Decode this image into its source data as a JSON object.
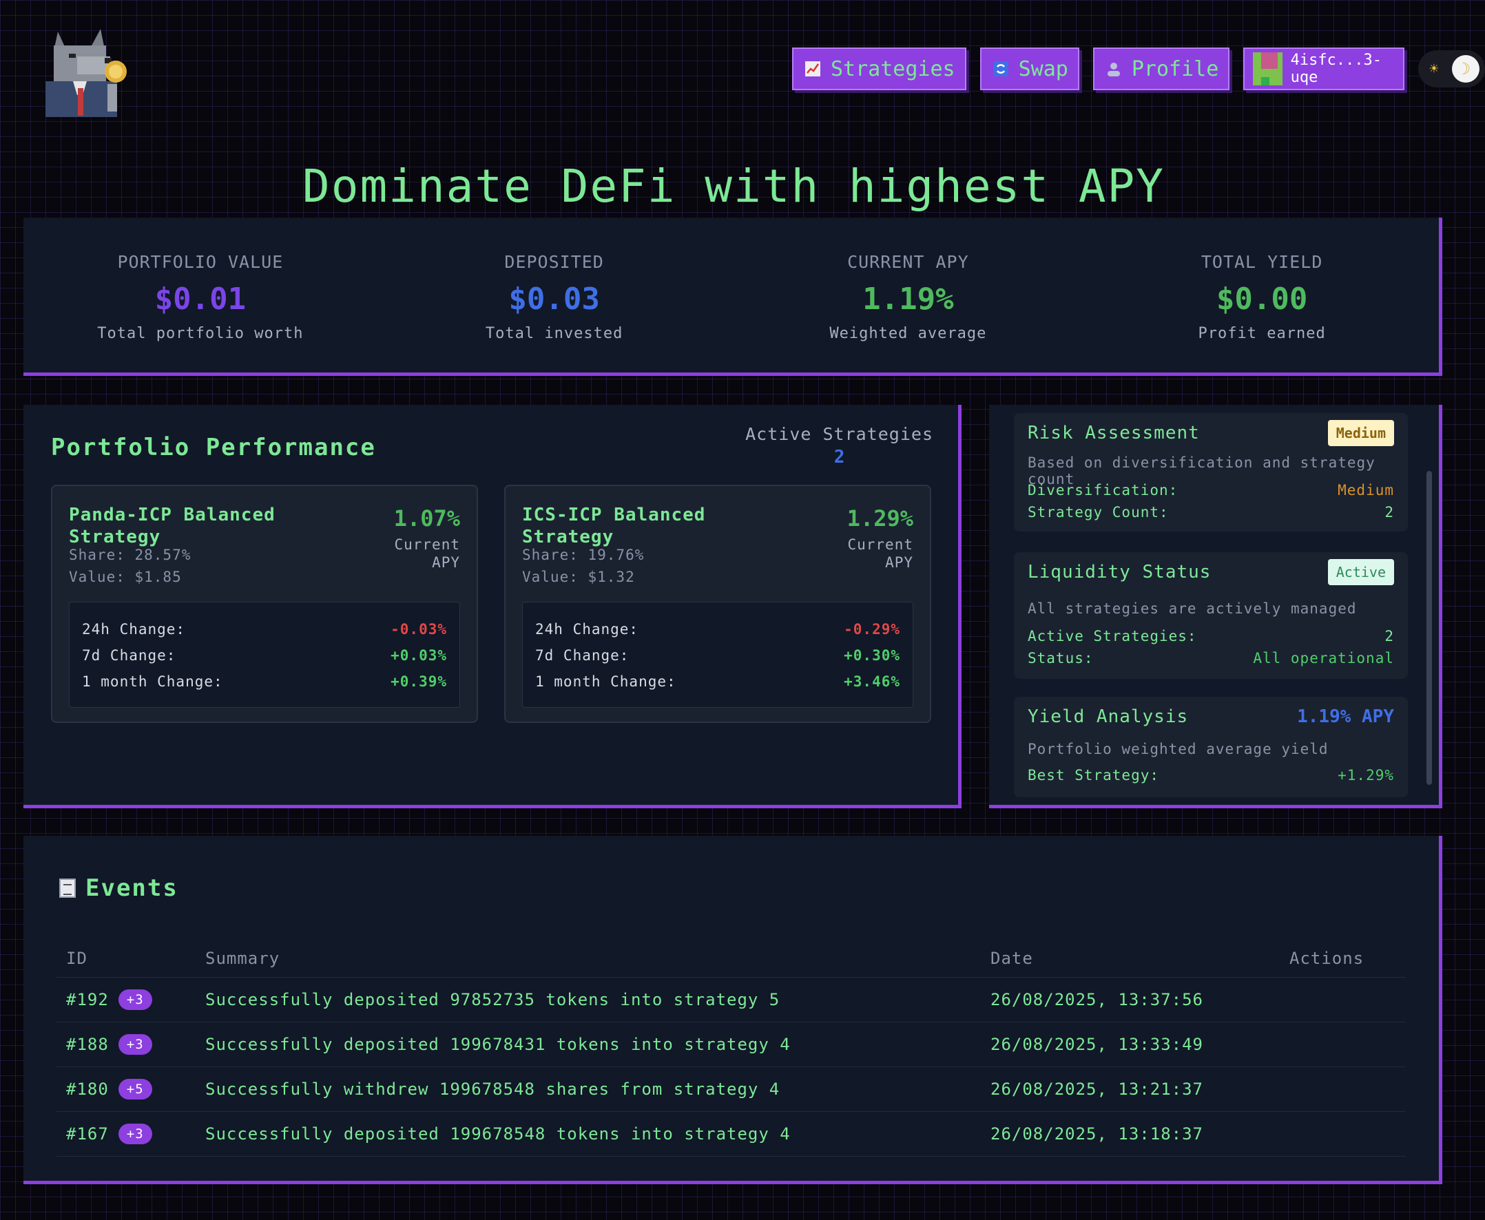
{
  "header": {
    "nav": [
      {
        "icon": "chart-icon",
        "label": "Strategies"
      },
      {
        "icon": "swap-icon",
        "label": "Swap"
      },
      {
        "icon": "user-icon",
        "label": "Profile"
      }
    ],
    "wallet_label": "4isfc...3-uqe",
    "theme_toggle": {
      "sun": "☀",
      "moon": "☽"
    }
  },
  "hero_title": "Dominate DeFi with highest APY",
  "stats": [
    {
      "label": "PORTFOLIO VALUE",
      "value": "$0.01",
      "sub": "Total portfolio worth",
      "color": "#7b45e8"
    },
    {
      "label": "DEPOSITED",
      "value": "$0.03",
      "sub": "Total invested",
      "color": "#3f6fe6"
    },
    {
      "label": "CURRENT APY",
      "value": "1.19%",
      "sub": "Weighted average",
      "color": "#4fba5e"
    },
    {
      "label": "TOTAL YIELD",
      "value": "$0.00",
      "sub": "Profit earned",
      "color": "#4fba5e"
    }
  ],
  "performance": {
    "title": "Portfolio Performance",
    "active_label": "Active Strategies",
    "active_count": "2",
    "strategies": [
      {
        "name": "Panda-ICP Balanced Strategy",
        "apy": "1.07%",
        "apy_label": "Current APY",
        "share": "Share: 28.57%",
        "value": "Value: $1.85",
        "changes": [
          {
            "label": "24h Change:",
            "value": "-0.03%"
          },
          {
            "label": "7d Change:",
            "value": "+0.03%"
          },
          {
            "label": "1 month Change:",
            "value": "+0.39%"
          }
        ]
      },
      {
        "name": "ICS-ICP Balanced Strategy",
        "apy": "1.29%",
        "apy_label": "Current APY",
        "share": "Share: 19.76%",
        "value": "Value: $1.32",
        "changes": [
          {
            "label": "24h Change:",
            "value": "-0.29%"
          },
          {
            "label": "7d Change:",
            "value": "+0.30%"
          },
          {
            "label": "1 month Change:",
            "value": "+3.46%"
          }
        ]
      }
    ]
  },
  "risk_panel": {
    "risk": {
      "title": "Risk Assessment",
      "badge": "Medium",
      "desc": "Based on diversification and strategy count",
      "rows": [
        {
          "label": "Diversification:",
          "value": "Medium"
        },
        {
          "label": "Strategy Count:",
          "value": "2"
        }
      ]
    },
    "liquidity": {
      "title": "Liquidity Status",
      "badge": "Active",
      "desc": "All strategies are actively managed",
      "rows": [
        {
          "label": "Active Strategies:",
          "value": "2"
        },
        {
          "label": "Status:",
          "value": "All operational"
        }
      ]
    },
    "yield": {
      "title": "Yield Analysis",
      "badge": "1.19% APY",
      "desc": "Portfolio weighted average yield",
      "rows": [
        {
          "label": "Best Strategy:",
          "value": "+1.29%"
        }
      ]
    }
  },
  "events": {
    "title": "Events",
    "icon": "receipt-icon",
    "columns": [
      "ID",
      "Summary",
      "Date",
      "Actions"
    ],
    "rows": [
      {
        "id": "#192",
        "badge": "+3",
        "summary": "Successfully deposited 97852735 tokens into strategy 5",
        "date": "26/08/2025, 13:37:56"
      },
      {
        "id": "#188",
        "badge": "+3",
        "summary": "Successfully deposited 199678431 tokens into strategy 4",
        "date": "26/08/2025, 13:33:49"
      },
      {
        "id": "#180",
        "badge": "+5",
        "summary": "Successfully withdrew 199678548 shares from strategy 4",
        "date": "26/08/2025, 13:21:37"
      },
      {
        "id": "#167",
        "badge": "+3",
        "summary": "Successfully deposited 199678548 tokens into strategy 4",
        "date": "26/08/2025, 13:18:37"
      }
    ]
  },
  "colors": {
    "accent": "#8d3fe0",
    "green": "#7de896",
    "panel": "#111827",
    "negative": "#e04848",
    "medium_badge_bg": "#fdf2c4",
    "medium_badge_fg": "#8a6410",
    "active_badge_bg": "#dcf7ec",
    "active_badge_fg": "#2e8a5a",
    "medium_value": "#d9932a"
  }
}
